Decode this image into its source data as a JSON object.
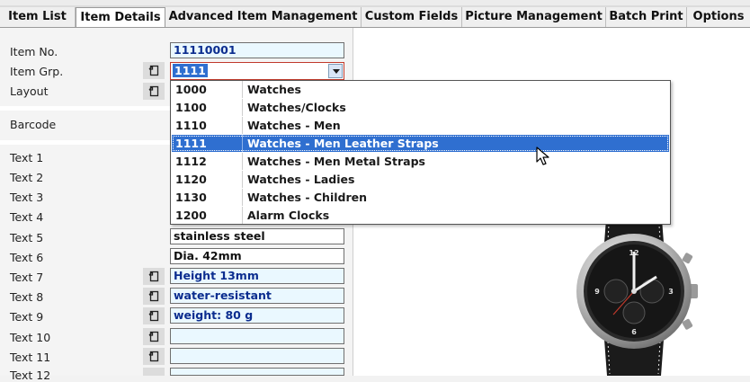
{
  "tabs": [
    {
      "label": "Item List",
      "active": false
    },
    {
      "label": "Item Details",
      "active": true
    },
    {
      "label": "Advanced Item Management",
      "active": false
    },
    {
      "label": "Custom Fields",
      "active": false
    },
    {
      "label": "Picture Management",
      "active": false
    },
    {
      "label": "Batch Print",
      "active": false
    },
    {
      "label": "Options",
      "active": false
    }
  ],
  "form": {
    "item_no_label": "Item No.",
    "item_no_value": "11110001",
    "item_grp_label": "Item Grp.",
    "item_grp_value": "1111",
    "layout_label": "Layout",
    "barcode_label": "Barcode",
    "texts": [
      {
        "label": "Text 1",
        "value": ""
      },
      {
        "label": "Text 2",
        "value": ""
      },
      {
        "label": "Text 3",
        "value": ""
      },
      {
        "label": "Text 4",
        "value": ""
      },
      {
        "label": "Text 5",
        "value": "stainless steel"
      },
      {
        "label": "Text 6",
        "value": "Dia. 42mm"
      },
      {
        "label": "Text 7",
        "value": "Height 13mm"
      },
      {
        "label": "Text 8",
        "value": "water-resistant"
      },
      {
        "label": "Text 9",
        "value": "weight: 80 g"
      },
      {
        "label": "Text 10",
        "value": ""
      },
      {
        "label": "Text 11",
        "value": ""
      },
      {
        "label": "Text 12",
        "value": ""
      }
    ]
  },
  "dropdown": {
    "items": [
      {
        "code": "1000",
        "name": "Watches"
      },
      {
        "code": "1100",
        "name": "Watches/Clocks"
      },
      {
        "code": "1110",
        "name": "Watches - Men"
      },
      {
        "code": "1111",
        "name": "Watches - Men Leather Straps",
        "selected": true
      },
      {
        "code": "1112",
        "name": "Watches - Men Metal Straps"
      },
      {
        "code": "1120",
        "name": "Watches - Ladies"
      },
      {
        "code": "1130",
        "name": "Watches - Children"
      },
      {
        "code": "1200",
        "name": "Alarm Clocks"
      }
    ]
  },
  "colors": {
    "selection": "#2f6fd0",
    "blue_field_bg": "#eaf8ff",
    "blue_field_text": "#0b2d8f"
  }
}
